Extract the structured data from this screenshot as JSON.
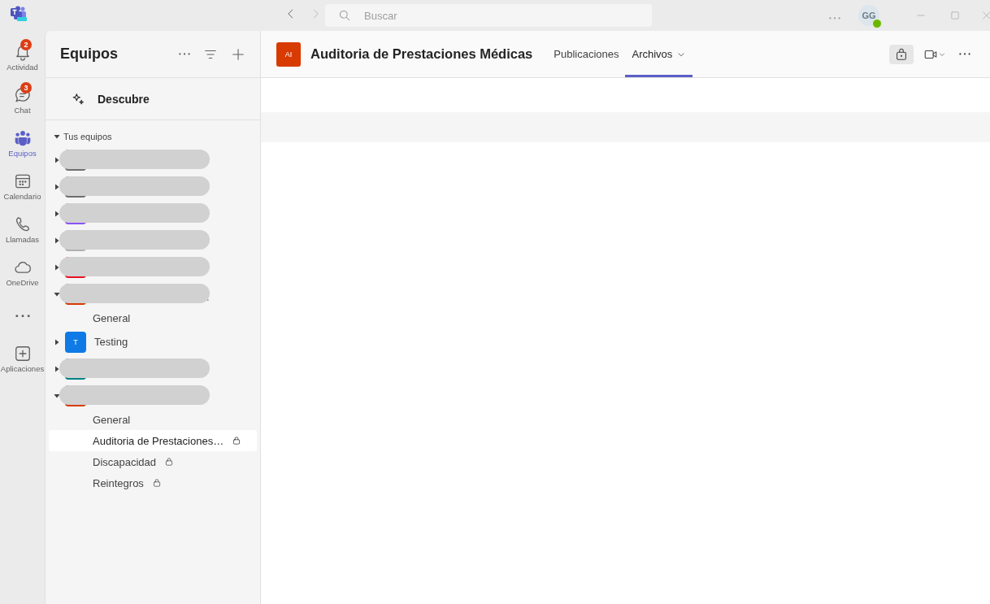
{
  "titlebar": {
    "search_placeholder": "Buscar",
    "avatar": "GG"
  },
  "rail": [
    {
      "kind": "item",
      "label": "Actividad",
      "badge": "2",
      "selected": false
    },
    {
      "kind": "item",
      "label": "Chat",
      "badge": "3",
      "selected": false
    },
    {
      "kind": "item",
      "label": "Equipos",
      "selected": true
    },
    {
      "kind": "item",
      "label": "Calendario",
      "selected": false
    },
    {
      "kind": "item",
      "label": "Llamadas",
      "selected": false
    },
    {
      "kind": "item",
      "label": "OneDrive",
      "selected": false
    },
    {
      "kind": "more"
    },
    {
      "kind": "item",
      "label": "Aplicaciones",
      "selected": false
    }
  ],
  "teams_panel": {
    "title": "Equipos",
    "discover": "Descubre",
    "section": {
      "label": "Tus equipos",
      "expanded": true
    },
    "teams": [
      {
        "kind": "redacted",
        "color": "#6e6e6e",
        "expanded": false
      },
      {
        "kind": "redacted",
        "color": "#6e6e6e",
        "expanded": false
      },
      {
        "kind": "redacted",
        "color": "#8a52f5",
        "expanded": false
      },
      {
        "kind": "redacted",
        "color": "#b0b0b0",
        "expanded": false
      },
      {
        "kind": "redacted",
        "color": "#e81123",
        "expanded": false
      },
      {
        "kind": "redacted",
        "color": "#d83b01",
        "expanded": true,
        "tail": "…",
        "channels": [
          {
            "name": "General",
            "private": false,
            "selected": false
          }
        ]
      },
      {
        "kind": "team",
        "name": "Testing",
        "initials": "T",
        "color": "#0f7ae5",
        "expanded": false
      },
      {
        "kind": "redacted",
        "color": "#038387",
        "expanded": false
      },
      {
        "kind": "redacted",
        "color": "#d83b01",
        "expanded": true,
        "channels": [
          {
            "name": "General",
            "private": false,
            "selected": false
          },
          {
            "name": "Auditoria de Prestaciones…",
            "private": true,
            "selected": true
          },
          {
            "name": "Discapacidad",
            "private": true,
            "selected": false
          },
          {
            "name": "Reintegros",
            "private": true,
            "selected": false
          }
        ]
      }
    ]
  },
  "channel_header": {
    "initials": "AI",
    "color": "#d83b01",
    "title": "Auditoria de Prestaciones Médicas",
    "tabs": [
      {
        "label": "Publicaciones",
        "selected": false,
        "dropdown": false
      },
      {
        "label": "Archivos",
        "selected": true,
        "dropdown": true
      }
    ]
  }
}
